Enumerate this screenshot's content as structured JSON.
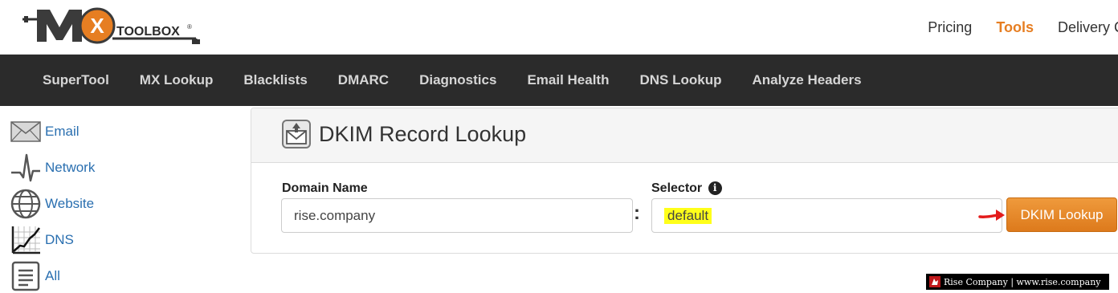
{
  "logo": {
    "brand_mx": "MX",
    "brand_toolbox": "TOOLBOX"
  },
  "topnav": {
    "pricing": "Pricing",
    "tools": "Tools",
    "delivery": "Delivery C"
  },
  "mainnav": [
    "SuperTool",
    "MX Lookup",
    "Blacklists",
    "DMARC",
    "Diagnostics",
    "Email Health",
    "DNS Lookup",
    "Analyze Headers"
  ],
  "sidebar": {
    "items": [
      {
        "label": "Email",
        "icon": "envelope-icon"
      },
      {
        "label": "Network",
        "icon": "pulse-icon"
      },
      {
        "label": "Website",
        "icon": "globe-icon"
      },
      {
        "label": "DNS",
        "icon": "chart-icon"
      },
      {
        "label": "All",
        "icon": "document-icon"
      }
    ]
  },
  "panel": {
    "title": "DKIM Record Lookup",
    "domain_label": "Domain Name",
    "domain_value": "rise.company",
    "colon": ":",
    "selector_label": "Selector",
    "selector_value": "default",
    "info_symbol": "i",
    "button_label": "DKIM Lookup"
  },
  "watermark": {
    "text": "Rise Company | www.rise.company"
  },
  "colors": {
    "accent": "#e67e22",
    "nav_bg": "#2b2b2b",
    "link": "#2a6fb0",
    "highlight": "#ffff1a",
    "arrow": "#e31b1b"
  }
}
